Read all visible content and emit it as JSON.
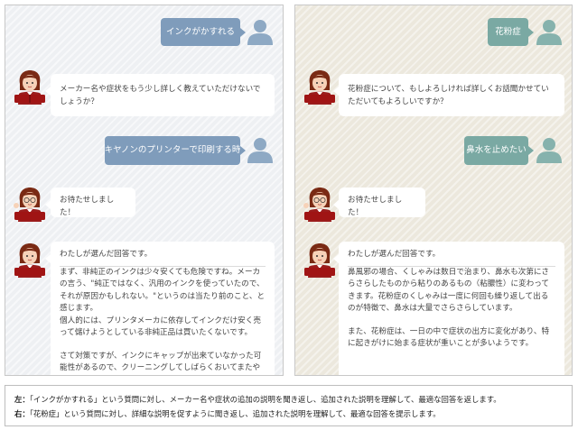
{
  "left_panel": {
    "user_msg_1": "インクがかすれる",
    "bot_msg_1": "メーカー名や症状をもう少し詳しく教えていただけないでしょうか？",
    "user_msg_2": "キヤノンのプリンターで印刷する時",
    "bot_msg_2": "お待たせしました！",
    "answer_head": "わたしが選んだ回答です。",
    "answer_lines": [
      "まず、非純正のインクは少々安くても危険ですね。メーカの言う、\"純正ではなく、汎用のインクを使っていたので、それが原因かもしれない。\"というのは当たり前のこと、と感じます。",
      "個人的には、プリンタメーカに依存してインクだけ安く売って儲けようとしている非純正品は買いたくないです。",
      "さて対策ですが、インクにキャップが出来ていなかった可能性があるので、クリーニングしてしばらくおいてまたやってみる"
    ]
  },
  "right_panel": {
    "user_msg_1": "花粉症",
    "bot_msg_1": "花粉症について、もしよろしければ詳しくお話聞かせていただいてもよろしいですか？",
    "user_msg_2": "鼻水を止めたい",
    "bot_msg_2": "お待たせしました！",
    "answer_head": "わたしが選んだ回答です。",
    "answer_lines": [
      "鼻風邪の場合、くしゃみは数日で治まり、鼻水も次第にさらさらしたものから粘りのあるもの（粘膿性）に変わってきます。花粉症のくしゃみは一度に何回も繰り返して出るのが特徴で、鼻水は大量でさらさらしています。",
      "また、花粉症は、一日の中で症状の出方に変化があり、特に起きがけに始まる症状が重いことが多いようです。"
    ]
  },
  "caption": {
    "left_label": "左：",
    "left_text": "「インクがかすれる」という質問に対し、メーカー名や症状の追加の説明を聞き返し、追加された説明を理解して、最適な回答を返します。",
    "right_label": "右：",
    "right_text": "「花粉症」という質問に対し、詳細な説明を促すように聞き返し、追加された説明を理解して、最適な回答を提示します。"
  },
  "colors": {
    "left_user_bubble": "#7f9cbb",
    "right_user_bubble": "#7aa9a3",
    "left_user_icon": "#8ea9c4",
    "right_user_icon": "#86b2ad",
    "left_bg": "#eef0f3",
    "right_bg": "#ece8dd"
  },
  "icons": [
    "user-silhouette-icon",
    "bot-avatar-icon"
  ]
}
